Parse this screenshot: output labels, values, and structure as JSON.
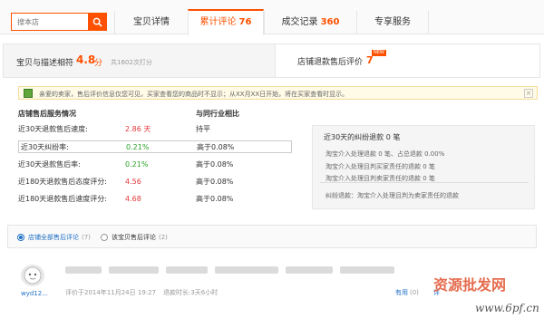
{
  "search": {
    "placeholder": "搜本店"
  },
  "tabs": [
    {
      "label": "宝贝详情",
      "count": ""
    },
    {
      "label": "累计评论",
      "count": "76"
    },
    {
      "label": "成交记录",
      "count": "360"
    },
    {
      "label": "专享服务",
      "count": ""
    }
  ],
  "rating": {
    "label": "宝贝与描述相符",
    "score": "4.8",
    "unit": "分",
    "count_text": "共1602次打分"
  },
  "after_sale": {
    "label": "店铺退款售后评价",
    "count": "7",
    "badge": "NEW"
  },
  "notice": "亲爱的卖家，售后评价信息仅您可见，买家查看您的商品时不显示；从XX月XX日开始，将在买家查看时显示。",
  "stats": {
    "header_left": "店铺售后服务情况",
    "header_right": "与同行业相比",
    "rows": [
      {
        "label": "近30天退款售后速度:",
        "value": "2.86 天",
        "compare": "持平"
      },
      {
        "label": "近30天纠纷率:",
        "value": "0.21%",
        "compare": "高于0.08%"
      },
      {
        "label": "近30天退款售后率:",
        "value": "0.21%",
        "compare": "高于0.08%"
      },
      {
        "label": "近180天退款售后态度评分:",
        "value": "4.56",
        "compare": "高于0.08%"
      },
      {
        "label": "近180天退款售后速度评分:",
        "value": "4.68",
        "compare": "高于0.08%"
      }
    ]
  },
  "refund_box": {
    "title": "近30天的纠纷退款 0 笔",
    "items": [
      "淘宝介入处理退款 0 笔、占总退款 0.00%",
      "淘宝介入处理且判买家责任的退款 0 笔",
      "淘宝介入处理且判卖家责任的退款 0 笔"
    ],
    "footer": "纠纷退款：淘宝介入处理且判为卖家责任的退款"
  },
  "filter": {
    "option1": {
      "label": "店铺全部售后评论",
      "count": "(7)"
    },
    "option2": {
      "label": "该宝贝售后评论",
      "count": "(2)"
    }
  },
  "review": {
    "user": "wyd12...",
    "time": "评价于2014年11月24日 19:27",
    "refund_duration": "退款时长:3天6小时",
    "useful_label": "有用",
    "useful_count": "(0)",
    "comment_label": "评"
  },
  "watermark": {
    "text": "资源批发网",
    "url": "www.6pf.cn"
  },
  "colors": {
    "accent": "#ff5000",
    "link": "#1e6fc4",
    "green": "#29a329"
  }
}
